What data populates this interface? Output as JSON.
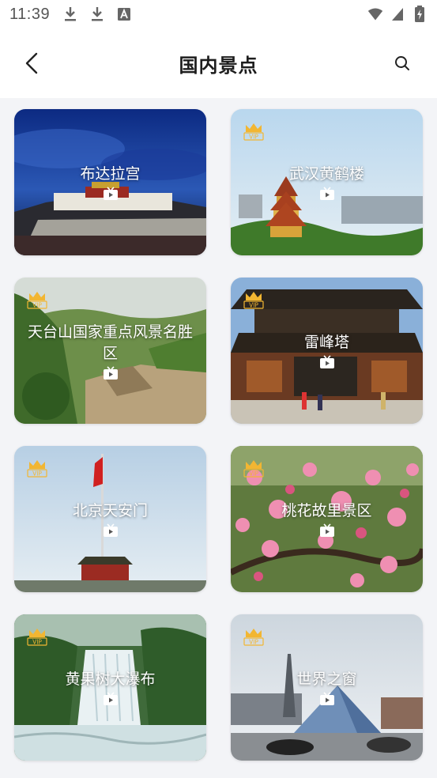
{
  "status_bar": {
    "time": "11:39",
    "left_icons": [
      "download-icon",
      "download-icon",
      "font-icon"
    ],
    "right_icons": [
      "wifi-icon",
      "signal-icon",
      "battery-charging-icon"
    ]
  },
  "header": {
    "title": "国内景点",
    "back_icon": "chevron-left-icon",
    "search_icon": "search-icon"
  },
  "colors": {
    "accent_vip": "#f2b632",
    "background": "#f3f4f7"
  },
  "badge": {
    "vip_text": "VIP"
  },
  "spots": [
    {
      "title": "布达拉宫",
      "vip": false
    },
    {
      "title": "武汉黄鹤楼",
      "vip": true
    },
    {
      "title": "天台山国家重点风景名胜区",
      "vip": true
    },
    {
      "title": "雷峰塔",
      "vip": true
    },
    {
      "title": "北京天安门",
      "vip": true
    },
    {
      "title": "桃花故里景区",
      "vip": true
    },
    {
      "title": "黄果树大瀑布",
      "vip": true
    },
    {
      "title": "世界之窗",
      "vip": true
    }
  ]
}
